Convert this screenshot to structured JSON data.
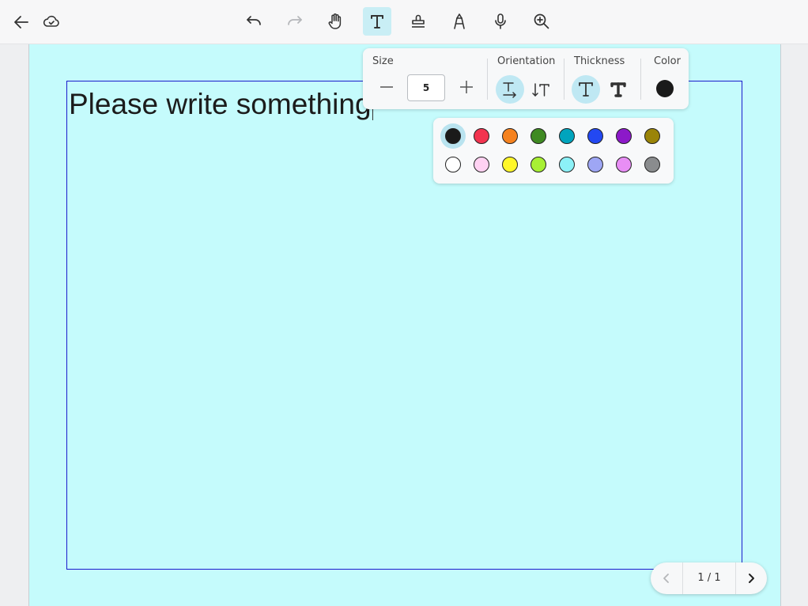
{
  "toolbar": {
    "back": "back-icon",
    "sync": "cloud-check-icon",
    "tools": [
      "undo-icon",
      "redo-icon",
      "hand-icon",
      "text-icon",
      "stamp-icon",
      "pen-icon",
      "microphone-icon",
      "zoom-in-icon"
    ],
    "active_tool": "text-icon"
  },
  "document": {
    "text": "Please write something",
    "page_color": "#c5fbfc",
    "box_color": "#1a1acc"
  },
  "text_panel": {
    "size_label": "Size",
    "size_value": "5",
    "orientation_label": "Orientation",
    "thickness_label": "Thickness",
    "color_label": "Color",
    "current_color": "#1a1a1a",
    "orientation_selected": "horizontal",
    "thickness_selected": "regular"
  },
  "palette": {
    "selected": "#1a1a1a",
    "row1": [
      "#1a1a1a",
      "#f2344f",
      "#f5821f",
      "#3f8a22",
      "#00a4bd",
      "#2348f2",
      "#8c19c9",
      "#9a8408"
    ],
    "row2": [
      "#ffffff",
      "#ffd2f2",
      "#fff72a",
      "#a8f034",
      "#8cf1f7",
      "#9ea6f4",
      "#e88ef5",
      "#8a8c8e"
    ]
  },
  "pager": {
    "text": "1 / 1"
  }
}
